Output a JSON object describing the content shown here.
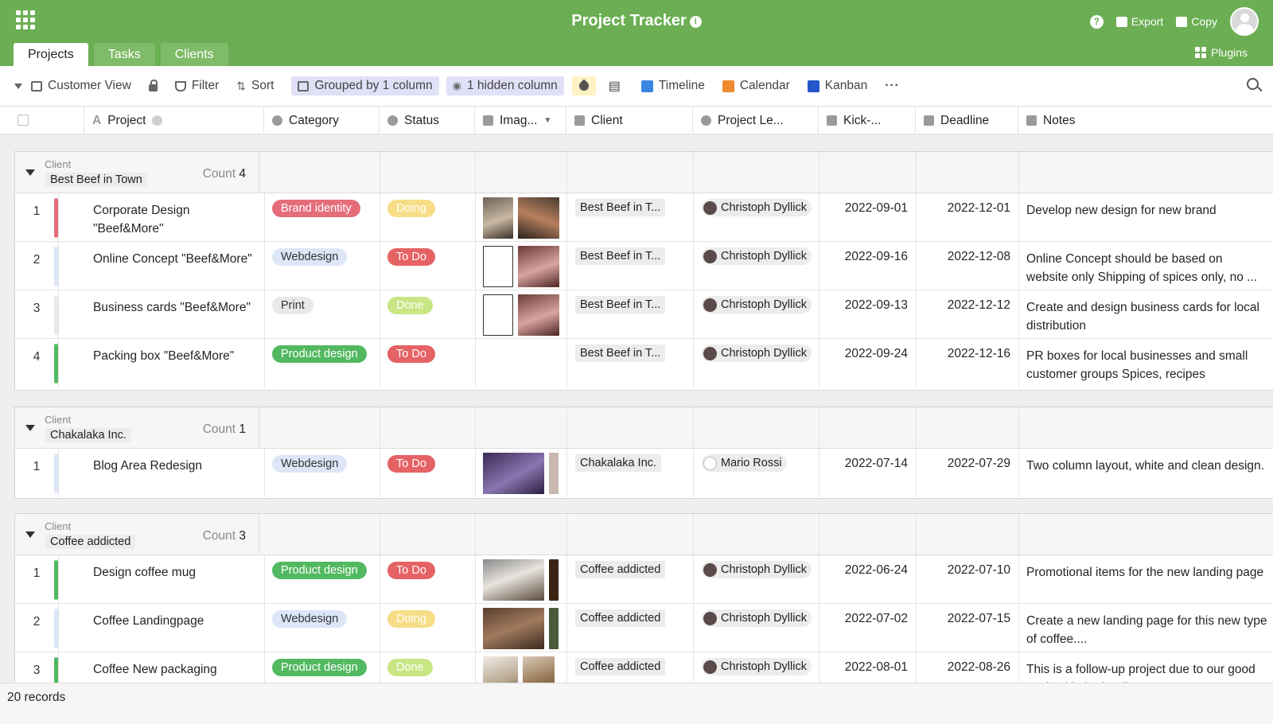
{
  "app": {
    "title": "Project Tracker"
  },
  "header": {
    "export_label": "Export",
    "copy_label": "Copy",
    "plugins_label": "Plugins"
  },
  "tabs": [
    {
      "label": "Projects"
    },
    {
      "label": "Tasks"
    },
    {
      "label": "Clients"
    }
  ],
  "toolbar": {
    "view_label": "Customer View",
    "filter_label": "Filter",
    "sort_label": "Sort",
    "group_label": "Grouped by 1 column",
    "hidden_label": "1 hidden column",
    "timeline_label": "Timeline",
    "calendar_label": "Calendar",
    "kanban_label": "Kanban",
    "more_label": "···"
  },
  "columns": {
    "project": "Project",
    "category": "Category",
    "status": "Status",
    "images": "Imag...",
    "client": "Client",
    "lead": "Project Le...",
    "kickoff": "Kick-...",
    "deadline": "Deadline",
    "notes": "Notes"
  },
  "group_label": "Client",
  "count_label": "Count",
  "groups": [
    {
      "name": "Best Beef in Town",
      "count": "4",
      "rows": [
        {
          "num": "1",
          "bar": "#e56d7a",
          "project": "Corporate Design \"Beef&More\"",
          "category": "Brand identity",
          "cat_style": "brand",
          "status": "Doing",
          "status_style": "doing",
          "client": "Best Beef in T...",
          "lead": "Christoph Dyllick",
          "kickoff": "2022-09-01",
          "deadline": "2022-12-01",
          "notes": "Develop new design for new brand"
        },
        {
          "num": "2",
          "bar": "#dde6f7",
          "project": "Online Concept \"Beef&More\"",
          "category": "Webdesign",
          "cat_style": "web",
          "status": "To Do",
          "status_style": "todo",
          "client": "Best Beef in T...",
          "lead": "Christoph Dyllick",
          "kickoff": "2022-09-16",
          "deadline": "2022-12-08",
          "notes": "Online Concept should be based on website only Shipping of spices only, no ..."
        },
        {
          "num": "3",
          "bar": "#e9e9e9",
          "project": "Business cards \"Beef&More\"",
          "category": "Print",
          "cat_style": "print",
          "status": "Done",
          "status_style": "done",
          "client": "Best Beef in T...",
          "lead": "Christoph Dyllick",
          "kickoff": "2022-09-13",
          "deadline": "2022-12-12",
          "notes": "Create and design business cards for local distribution"
        },
        {
          "num": "4",
          "bar": "#52b961",
          "project": "Packing box \"Beef&More\"",
          "category": "Product design",
          "cat_style": "product",
          "status": "To Do",
          "status_style": "todo",
          "client": "Best Beef in T...",
          "lead": "Christoph Dyllick",
          "kickoff": "2022-09-24",
          "deadline": "2022-12-16",
          "notes": "PR boxes for local businesses and small customer groups Spices, recipes"
        }
      ]
    },
    {
      "name": "Chakalaka Inc.",
      "count": "1",
      "rows": [
        {
          "num": "1",
          "bar": "#dde6f7",
          "project": "Blog Area Redesign",
          "category": "Webdesign",
          "cat_style": "web",
          "status": "To Do",
          "status_style": "todo",
          "client": "Chakalaka Inc.",
          "lead": "Mario Rossi",
          "kickoff": "2022-07-14",
          "deadline": "2022-07-29",
          "notes": "Two column layout, white and clean design."
        }
      ]
    },
    {
      "name": "Coffee addicted",
      "count": "3",
      "rows": [
        {
          "num": "1",
          "bar": "#52b961",
          "project": "Design coffee mug",
          "category": "Product design",
          "cat_style": "product",
          "status": "To Do",
          "status_style": "todo",
          "client": "Coffee addicted",
          "lead": "Christoph Dyllick",
          "kickoff": "2022-06-24",
          "deadline": "2022-07-10",
          "notes": "Promotional items for the new landing page"
        },
        {
          "num": "2",
          "bar": "#dde6f7",
          "project": "Coffee Landingpage",
          "category": "Webdesign",
          "cat_style": "web",
          "status": "Doing",
          "status_style": "doing",
          "client": "Coffee addicted",
          "lead": "Christoph Dyllick",
          "kickoff": "2022-07-02",
          "deadline": "2022-07-15",
          "notes": "Create a new landing page for this new type of coffee...."
        },
        {
          "num": "3",
          "bar": "#52b961",
          "project": "Coffee New packaging",
          "category": "Product design",
          "cat_style": "product",
          "status": "Done",
          "status_style": "done",
          "client": "Coffee addicted",
          "lead": "Christoph Dyllick",
          "kickoff": "2022-08-01",
          "deadline": "2022-08-26",
          "notes": "This is a follow-up project due to our good work with the landing page...."
        }
      ]
    }
  ],
  "footer": {
    "records": "20 records"
  }
}
